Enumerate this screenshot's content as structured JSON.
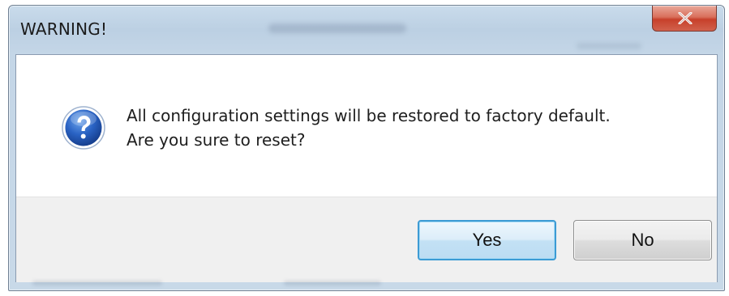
{
  "window": {
    "title": "WARNING!",
    "close_icon": "close-icon"
  },
  "dialog": {
    "icon": "question-icon",
    "message_line1": "All configuration settings will be restored to factory default.",
    "message_line2": "Are you sure to reset?"
  },
  "buttons": {
    "yes_label": "Yes",
    "no_label": "No"
  },
  "colors": {
    "accent_focus": "#3c9bd4",
    "close_button": "#c7402b",
    "question_icon": "#1f57b3"
  }
}
